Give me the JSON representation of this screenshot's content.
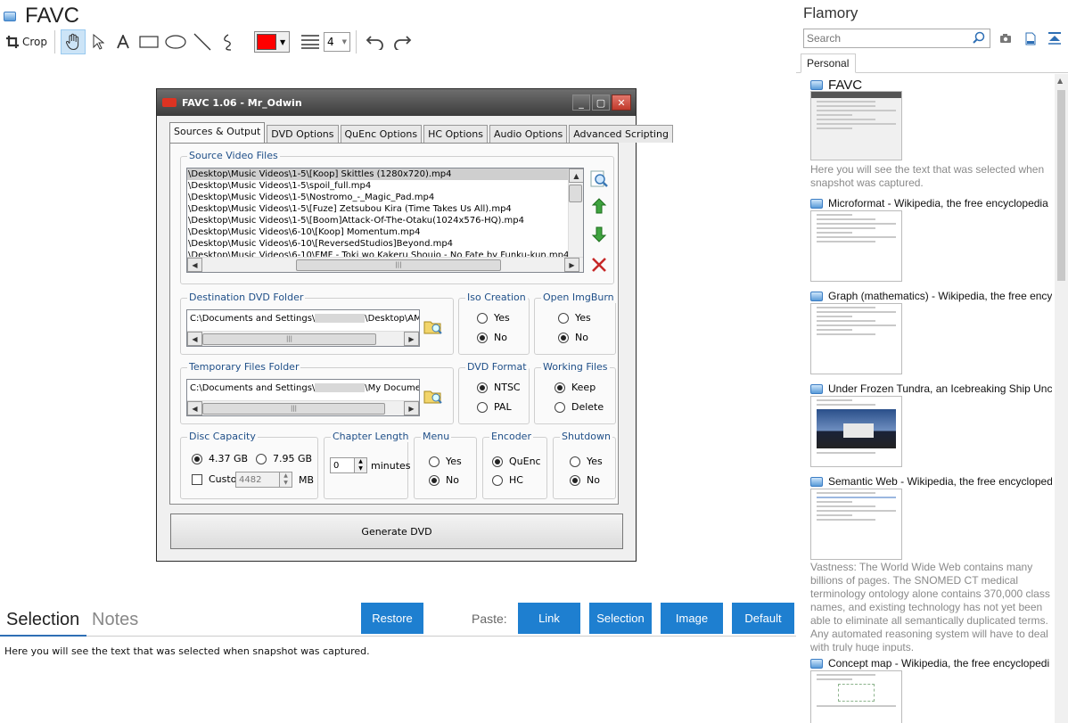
{
  "app": {
    "title": "FAVC"
  },
  "toolbar": {
    "crop_label": "Crop",
    "stroke_color": "#ff0000",
    "line_width": "4"
  },
  "screenshot": {
    "window_title": "FAVC 1.06 - Mr_Odwin",
    "tabs": [
      "Sources & Output",
      "DVD Options",
      "QuEnc Options",
      "HC Options",
      "Audio Options",
      "Advanced Scripting"
    ],
    "source_files_label": "Source Video Files",
    "files": [
      "\\Desktop\\Music Videos\\1-5\\[Koop] Skittles (1280x720).mp4",
      "\\Desktop\\Music Videos\\1-5\\spoil_full.mp4",
      "\\Desktop\\Music Videos\\1-5\\Nostromo_-_Magic_Pad.mp4",
      "\\Desktop\\Music Videos\\1-5\\[Fuze] Zetsubou Kira (Time Takes Us All).mp4",
      "\\Desktop\\Music Videos\\1-5\\[Boom]Attack-Of-The-Otaku(1024x576-HQ).mp4",
      "\\Desktop\\Music Videos\\6-10\\[Koop] Momentum.mp4",
      "\\Desktop\\Music Videos\\6-10\\[ReversedStudios]Beyond.mp4",
      "\\Desktop\\Music Videos\\6-10\\FMF - Toki wo Kakeru Shoujo - No Fate by Funku-kun.mp4"
    ],
    "dest_label": "Destination DVD Folder",
    "dest_path_a": "C:\\Documents and Settings\\",
    "dest_path_b": "\\Desktop\\AM",
    "iso_label": "Iso Creation",
    "imgburn_label": "Open ImgBurn",
    "yes": "Yes",
    "no": "No",
    "temp_label": "Temporary Files Folder",
    "temp_path_a": "C:\\Documents and Settings\\",
    "temp_path_b": "\\My Documen",
    "dvd_format_label": "DVD Format",
    "ntsc": "NTSC",
    "pal": "PAL",
    "working_label": "Working Files",
    "keep": "Keep",
    "delete": "Delete",
    "disc_label": "Disc Capacity",
    "disc_a": "4.37 GB",
    "disc_b": "7.95 GB",
    "custom": "Custom",
    "custom_value": "4482",
    "mb": "MB",
    "chapter_label": "Chapter Length",
    "chapter_value": "0",
    "minutes": "minutes",
    "menu_label": "Menu",
    "encoder_label": "Encoder",
    "quenc": "QuEnc",
    "hc": "HC",
    "shutdown_label": "Shutdown",
    "generate": "Generate DVD"
  },
  "notes": {
    "tab_selection": "Selection",
    "tab_notes": "Notes",
    "restore": "Restore",
    "paste_label": "Paste:",
    "paste_link": "Link",
    "paste_selection": "Selection",
    "paste_image": "Image",
    "paste_default": "Default",
    "selection_text": "Here you will see the text that was selected when snapshot was captured."
  },
  "sidebar": {
    "brand": "Flamory",
    "search_placeholder": "Search",
    "tab": "Personal",
    "snapshots": [
      {
        "title": "FAVC",
        "desc": "Here you will see the text that was selected when snapshot was captured."
      },
      {
        "title": "Microformat - Wikipedia, the free encyclopedia",
        "desc": ""
      },
      {
        "title": "Graph (mathematics) - Wikipedia, the free ency",
        "desc": ""
      },
      {
        "title": "Under Frozen Tundra, an Icebreaking Ship Unco",
        "desc": ""
      },
      {
        "title": "Semantic Web - Wikipedia, the free encycloped",
        "desc": "Vastness: The World Wide Web contains many billions of pages. The SNOMED CT medical terminology ontology alone contains 370,000 class names, and existing technology has not yet been able to eliminate all semantically duplicated terms. Any automated reasoning system will have to deal with truly huge inputs."
      },
      {
        "title": "Concept map - Wikipedia, the free encyclopedi",
        "desc": ""
      }
    ]
  },
  "colors": {
    "accent": "#1e7fd0",
    "tab_underline": "#2e6fb5"
  }
}
